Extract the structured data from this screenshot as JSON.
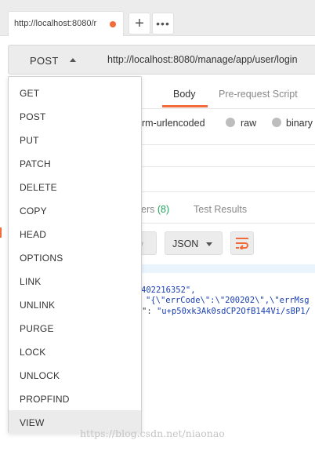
{
  "tab_bar": {
    "active_tab_title": "http://localhost:8080/r",
    "new_tab_icon": "plus-icon",
    "more_icon": "ellipsis-icon",
    "unsaved_dot_color": "#f26b3a"
  },
  "request": {
    "method": "POST",
    "url": "http://localhost:8080/manage/app/user/login"
  },
  "request_tabs": {
    "headers_count_fragment": ")",
    "body": "Body",
    "pre_request_script": "Pre-request Script"
  },
  "body_types": {
    "form_urlencoded_fragment": "orm-urlencoded",
    "raw": "raw",
    "binary": "binary"
  },
  "response_tabs": {
    "headers_fragment": "ers",
    "headers_count": "(8)",
    "test_results": "Test Results"
  },
  "response_toolbar": {
    "view_fragment": "w",
    "format": "JSON",
    "wrap_icon": "wrap-lines-icon"
  },
  "response_body": {
    "line1": "402216352\",",
    "line2": "\"{\\\"errCode\\\":\\\"200202\\\",\\\"errMsg",
    "line3_prefix": "\": ",
    "line3_value": "\"u+p50xk3Ak0sdCP2OfB144Vi/sBP1/"
  },
  "method_menu": {
    "items": [
      "GET",
      "POST",
      "PUT",
      "PATCH",
      "DELETE",
      "COPY",
      "HEAD",
      "OPTIONS",
      "LINK",
      "UNLINK",
      "PURGE",
      "LOCK",
      "UNLOCK",
      "PROPFIND",
      "VIEW"
    ],
    "highlighted": "VIEW"
  },
  "watermark": "https://blog.csdn.net/niaonao",
  "colors": {
    "accent": "#f26b3a",
    "count_green": "#1fa35a",
    "json_string": "#1a3fb0"
  }
}
